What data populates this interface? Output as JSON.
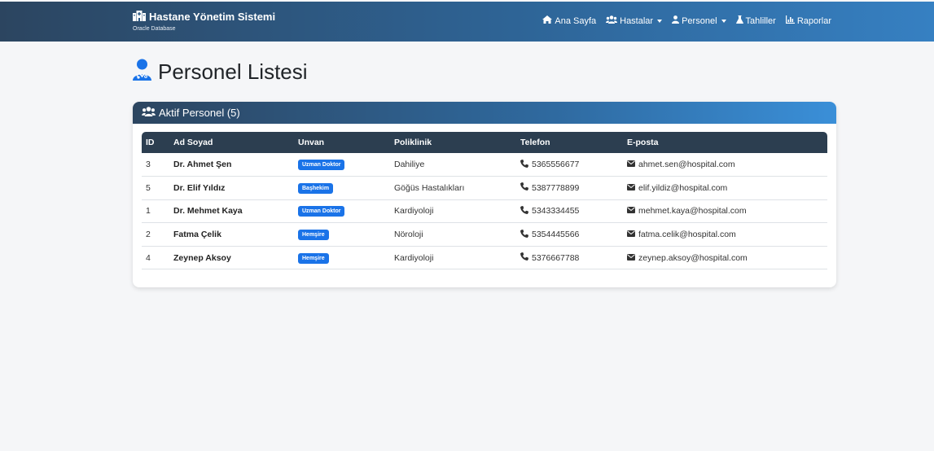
{
  "navbar": {
    "brand_title": "Hastane Yönetim Sistemi",
    "brand_subtitle": "Oracle Database",
    "links": {
      "home": "Ana Sayfa",
      "patients": "Hastalar",
      "staff": "Personel",
      "tests": "Tahliller",
      "reports": "Raporlar"
    }
  },
  "page": {
    "title": "Personel Listesi"
  },
  "card": {
    "header": "Aktif Personel (5)"
  },
  "table": {
    "headers": {
      "id": "ID",
      "name": "Ad Soyad",
      "title": "Unvan",
      "clinic": "Poliklinik",
      "phone": "Telefon",
      "email": "E-posta"
    },
    "rows": [
      {
        "id": "3",
        "name": "Dr. Ahmet Şen",
        "title": "Uzman Doktor",
        "clinic": "Dahiliye",
        "phone": "5365556677",
        "email": "ahmet.sen@hospital.com"
      },
      {
        "id": "5",
        "name": "Dr. Elif Yıldız",
        "title": "Başhekim",
        "clinic": "Göğüs Hastalıkları",
        "phone": "5387778899",
        "email": "elif.yildiz@hospital.com"
      },
      {
        "id": "1",
        "name": "Dr. Mehmet Kaya",
        "title": "Uzman Doktor",
        "clinic": "Kardiyoloji",
        "phone": "5343334455",
        "email": "mehmet.kaya@hospital.com"
      },
      {
        "id": "2",
        "name": "Fatma Çelik",
        "title": "Hemşire",
        "clinic": "Nöroloji",
        "phone": "5354445566",
        "email": "fatma.celik@hospital.com"
      },
      {
        "id": "4",
        "name": "Zeynep Aksoy",
        "title": "Hemşire",
        "clinic": "Kardiyoloji",
        "phone": "5376667788",
        "email": "zeynep.aksoy@hospital.com"
      }
    ]
  },
  "colors": {
    "nav_start": "#2c4560",
    "nav_end": "#3680c2",
    "table_header": "#2c3e50",
    "badge": "#1a73e8",
    "accent_icon": "#1a73e8"
  },
  "icons": [
    "hospital-icon",
    "home-icon",
    "users-icon",
    "user-icon",
    "flask-icon",
    "chart-icon",
    "doctor-icon",
    "phone-icon",
    "envelope-icon"
  ]
}
